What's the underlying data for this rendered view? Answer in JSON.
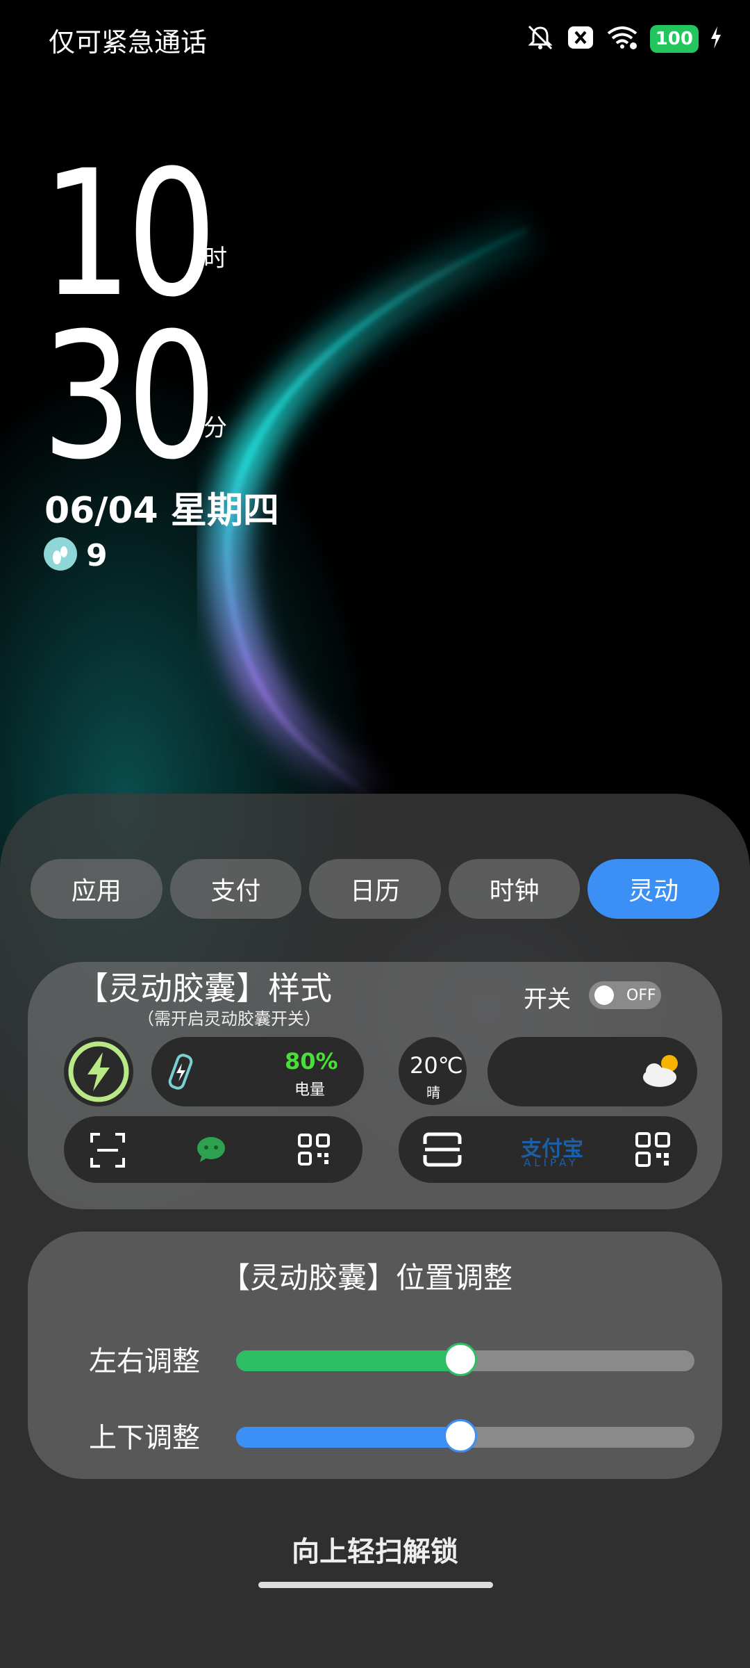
{
  "status_bar": {
    "carrier": "仅可紧急通话",
    "battery": "100",
    "icons": [
      "vibrate-off-icon",
      "close-box-icon",
      "wifi-icon",
      "battery-icon",
      "charging-icon"
    ]
  },
  "lockscreen": {
    "hour": "10",
    "hour_unit": "时",
    "minute": "30",
    "minute_unit": "分",
    "date": "06/04 星期四",
    "steps": "9"
  },
  "tabs": [
    {
      "label": "应用",
      "active": false
    },
    {
      "label": "支付",
      "active": false
    },
    {
      "label": "日历",
      "active": false
    },
    {
      "label": "时钟",
      "active": false
    },
    {
      "label": "灵动",
      "active": true
    }
  ],
  "style_card": {
    "title": "【灵动胶囊】样式",
    "subtitle": "（需开启灵动胶囊开关）",
    "toggle_label": "开关",
    "toggle_state": "OFF",
    "battery_percent": "80%",
    "battery_label": "电量",
    "temperature": "20℃",
    "weather_condition": "晴",
    "alipay_cn": "支付宝",
    "alipay_en": "ALIPAY"
  },
  "position_card": {
    "title": "【灵动胶囊】位置调整",
    "horizontal_label": "左右调整",
    "vertical_label": "上下调整",
    "horizontal_value": 0.49,
    "vertical_value": 0.49,
    "horizontal_color": "#2dbd63",
    "vertical_color": "#3b8ff5"
  },
  "unlock_hint": "向上轻扫解锁",
  "colors": {
    "accent": "#3b8ff5",
    "battery_green": "#22c55e",
    "percent_green": "#4ade3a"
  }
}
